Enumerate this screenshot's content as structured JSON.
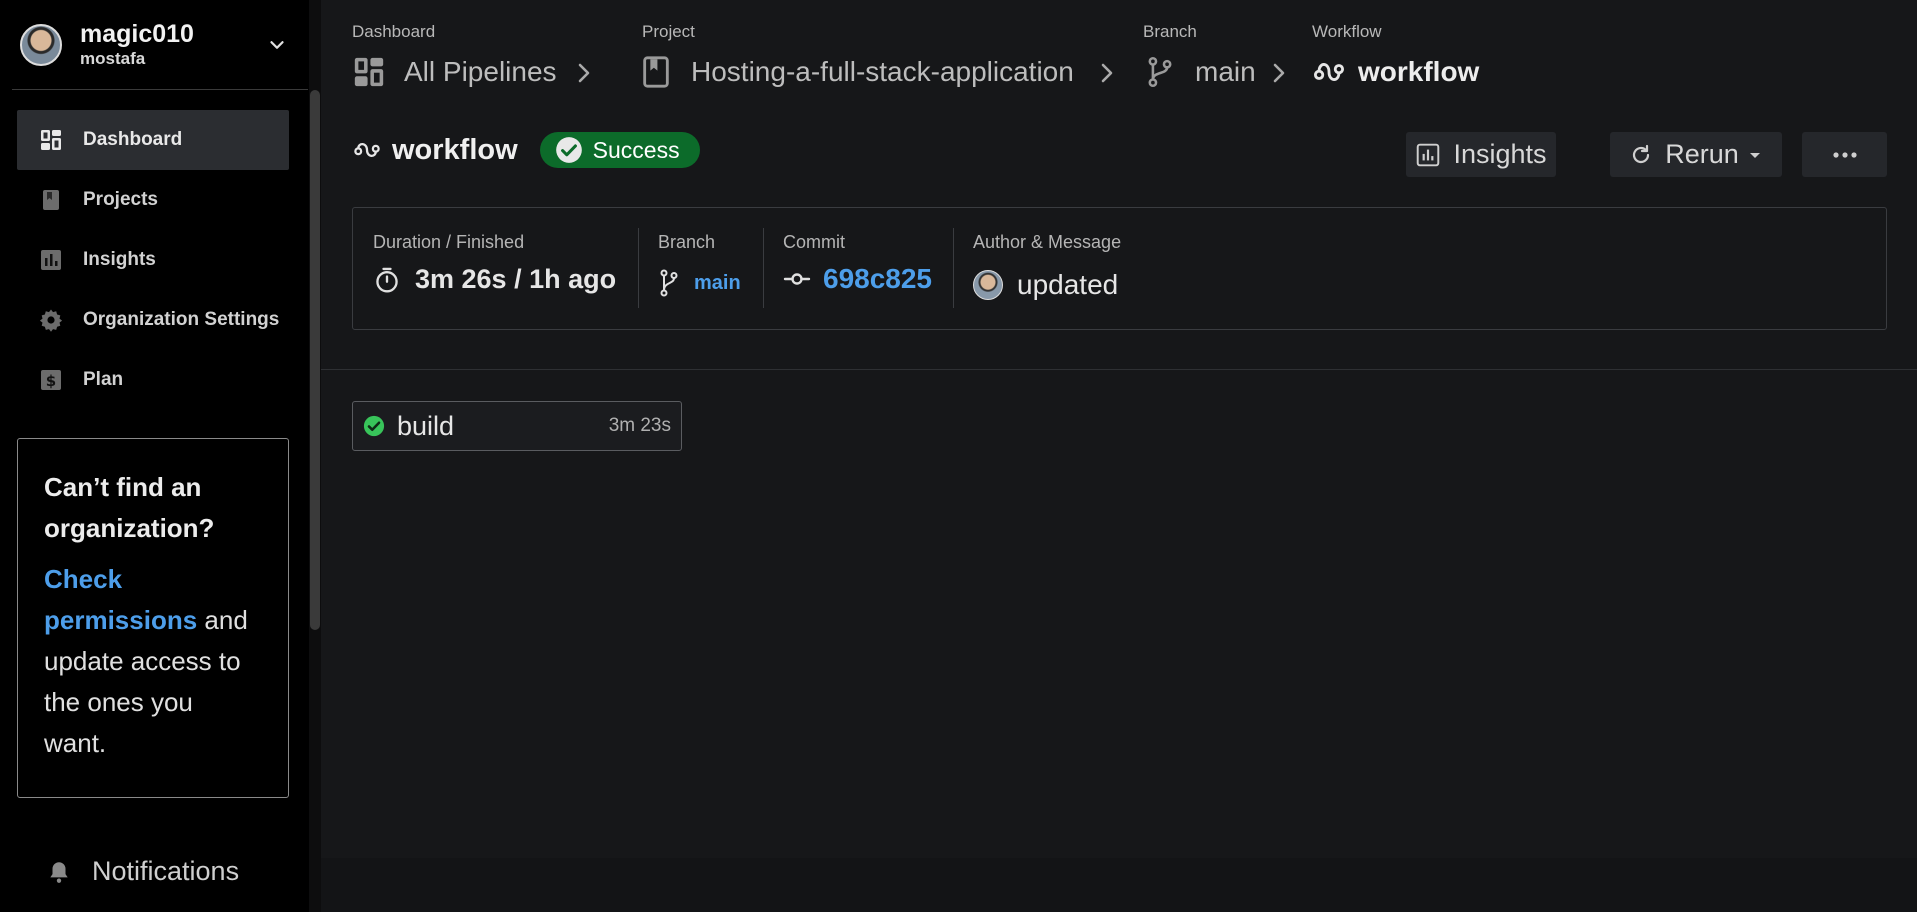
{
  "org": {
    "name": "magic010",
    "user": "mostafa"
  },
  "nav": {
    "items": [
      {
        "label": "Dashboard",
        "icon": "dashboard-icon",
        "active": true
      },
      {
        "label": "Projects",
        "icon": "book-icon",
        "active": false
      },
      {
        "label": "Insights",
        "icon": "bar-chart-icon",
        "active": false
      },
      {
        "label": "Organization Settings",
        "icon": "gear-icon",
        "active": false
      },
      {
        "label": "Plan",
        "icon": "dollar-icon",
        "active": false
      }
    ]
  },
  "promo": {
    "title": "Can’t find an organization?",
    "link_text": "Check permissions",
    "body_text": " and update access to the ones you want."
  },
  "notifications": {
    "label": "Notifications"
  },
  "breadcrumbs": [
    {
      "caption": "Dashboard",
      "label": "All Pipelines",
      "icon": "dashboard-icon"
    },
    {
      "caption": "Project",
      "label": "Hosting-a-full-stack-application",
      "icon": "book-icon"
    },
    {
      "caption": "Branch",
      "label": "main",
      "icon": "branch-icon"
    },
    {
      "caption": "Workflow",
      "label": "workflow",
      "icon": "workflow-icon"
    }
  ],
  "workflow": {
    "title": "workflow",
    "status": "Success",
    "status_color": "#0c6b2a"
  },
  "toolbar": {
    "insights_label": "Insights",
    "rerun_label": "Rerun",
    "more_label": "···"
  },
  "summary": {
    "duration_caption": "Duration / Finished",
    "duration_value": "3m 26s / 1h ago",
    "branch_caption": "Branch",
    "branch_value": "main",
    "commit_caption": "Commit",
    "commit_value": "698c825",
    "author_caption": "Author & Message",
    "message_value": "updated"
  },
  "jobs": [
    {
      "name": "build",
      "duration": "3m 23s",
      "status": "success"
    }
  ],
  "colors": {
    "accent_blue": "#4d9eea",
    "success_green": "#38c45a",
    "sidebar_bg": "#000000",
    "main_bg": "#161719"
  }
}
